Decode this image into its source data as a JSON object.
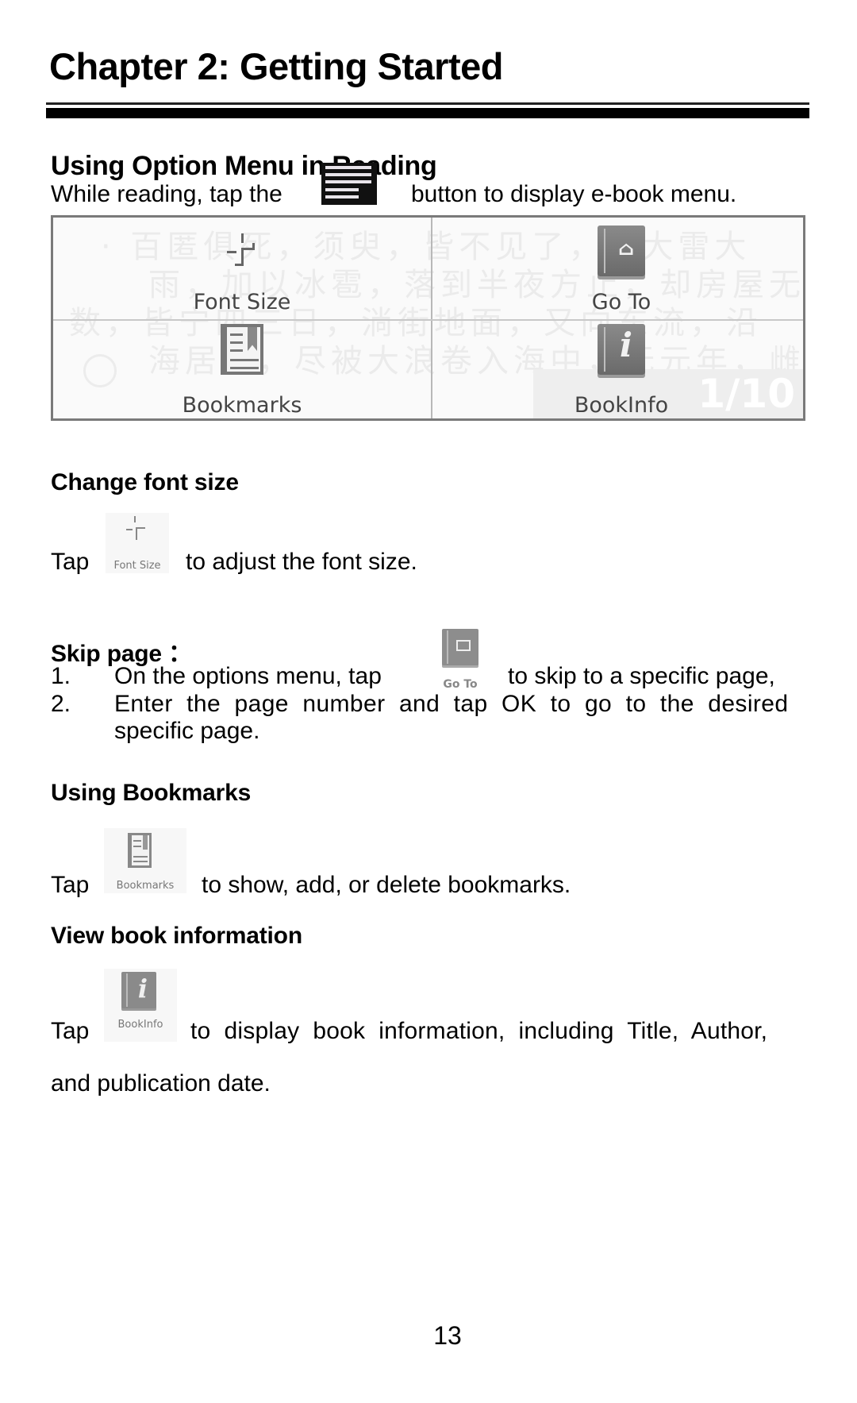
{
  "chapter_title": "Chapter 2: Getting Started",
  "section_option_menu": {
    "heading": "Using Option Menu in Reading",
    "intro_before": "While reading, tap the",
    "intro_icon": "menu-button-icon",
    "intro_after": "button to  display e-book menu."
  },
  "reader_menu": {
    "background_text": [
      "· 百匿俱死，须臾，皆不见了，忽大雷大",
      "雨，加以冰雹，落到半夜方止，却房屋无",
      "数，皆宁四三日，淌街地面，又向东流，沿",
      "海居民，尽被大浪卷入海中，无元年，雌"
    ],
    "items": [
      {
        "label": "Font Size",
        "icon": "font-size-icon"
      },
      {
        "label": "Go To",
        "icon": "go-to-book-icon"
      },
      {
        "label": "Bookmarks",
        "icon": "bookmarks-icon"
      },
      {
        "label": "BookInfo",
        "icon": "book-info-icon"
      }
    ],
    "page_indicator": "1/10"
  },
  "section_font_size": {
    "heading": "Change font size",
    "tap": "Tap",
    "icon_caption": "Font Size",
    "text": "to adjust the font size."
  },
  "section_skip_page": {
    "heading": "Skip page  ：",
    "steps": [
      {
        "num": "1.",
        "before": "On the options menu, tap",
        "icon_caption": "Go To",
        "after": "to skip to a specific page,"
      },
      {
        "num": "2.",
        "line1": "Enter  the  page  number  and  tap  OK  to  go  to  the  desired",
        "line2": "specific page."
      }
    ]
  },
  "section_bookmarks": {
    "heading": "Using Bookmarks",
    "tap": "Tap",
    "icon_caption": "Bookmarks",
    "text": "to show, add, or delete bookmarks."
  },
  "section_book_info": {
    "heading": "View book information",
    "tap": "Tap",
    "icon_caption": "BookInfo",
    "text": "to  display  book  information,  including  Title,  Author,",
    "text_line2": "and publication date."
  },
  "page_number": "13"
}
